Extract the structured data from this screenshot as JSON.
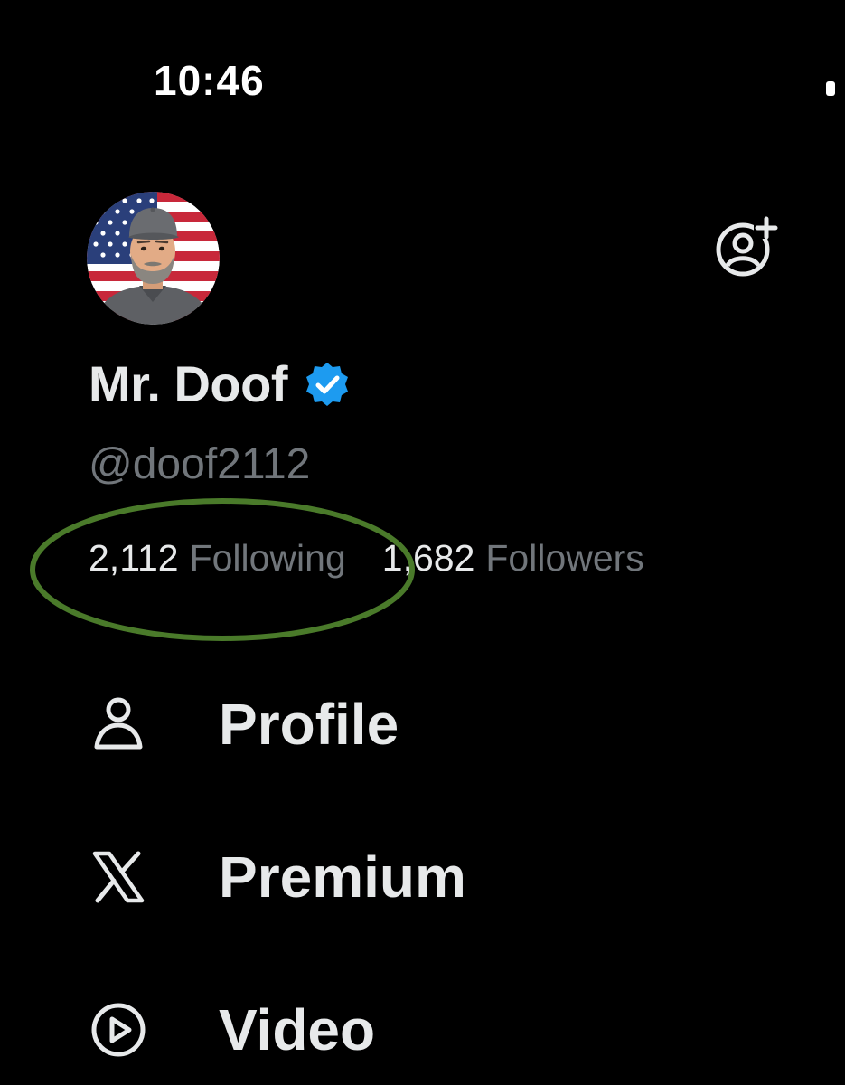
{
  "status_bar": {
    "time": "10:46"
  },
  "account": {
    "display_name": "Mr. Doof",
    "handle": "@doof2112",
    "verified": true,
    "avatar_icon": "cartoon-man-flag-avatar",
    "add_account_icon": "add-account-icon"
  },
  "stats": {
    "following": {
      "count": "2,112",
      "label": "Following"
    },
    "followers": {
      "count": "1,682",
      "label": "Followers"
    }
  },
  "menu": {
    "items": [
      {
        "icon": "person-icon",
        "label": "Profile"
      },
      {
        "icon": "x-logo-icon",
        "label": "Premium"
      },
      {
        "icon": "play-circle-icon",
        "label": "Video"
      }
    ]
  },
  "colors": {
    "background": "#000000",
    "primary_text": "#e7e9ea",
    "secondary_text": "#71767b",
    "verified_blue": "#1d9bf0",
    "highlight_ring": "#4a7a2a"
  }
}
